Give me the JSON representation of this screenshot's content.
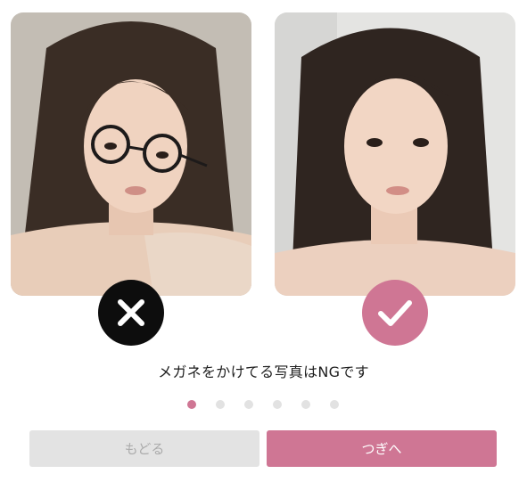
{
  "examples": {
    "ng": {
      "icon": "cross-icon",
      "badge_color": "#0d0d0d"
    },
    "ok": {
      "icon": "check-icon",
      "badge_color": "#cf7694"
    }
  },
  "caption": "メガネをかけてる写真はNGです",
  "pagination": {
    "total": 6,
    "current": 1
  },
  "buttons": {
    "back_label": "もどる",
    "next_label": "つぎへ"
  },
  "colors": {
    "accent": "#cf7694",
    "disabled_bg": "#e3e3e3",
    "disabled_text": "#ababab"
  }
}
